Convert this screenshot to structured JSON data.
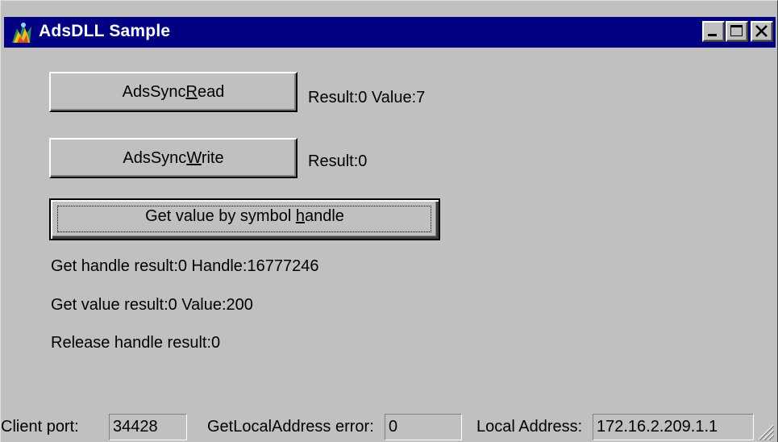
{
  "window": {
    "title": "AdsDLL Sample",
    "title_icon": "ads-app-icon",
    "controls": [
      "minimize-icon",
      "maximize-icon",
      "close-icon"
    ]
  },
  "buttons": {
    "sync_read": {
      "prefix": "AdsSync",
      "accel": "R",
      "suffix": "ead"
    },
    "sync_write": {
      "prefix": "AdsSync",
      "accel": "W",
      "suffix": "rite"
    },
    "symbol_handle": {
      "prefix": "Get value by symbol ",
      "accel": "h",
      "suffix": "andle"
    }
  },
  "results": {
    "read": "Result:0  Value:7",
    "write": "Result:0",
    "get_handle": "Get handle result:0   Handle:16777246",
    "get_value": "Get value result:0   Value:200",
    "release_handle": "Release handle result:0"
  },
  "status": {
    "client_port_label": "Client port:",
    "client_port_value": "34428",
    "local_address_error_label": "GetLocalAddress error:",
    "local_address_error_value": "0",
    "local_address_label": "Local Address:",
    "local_address_value": "172.16.2.209.1.1"
  },
  "colors": {
    "title_bar": "#000080",
    "face": "#c0c0c0",
    "text": "#000000"
  }
}
